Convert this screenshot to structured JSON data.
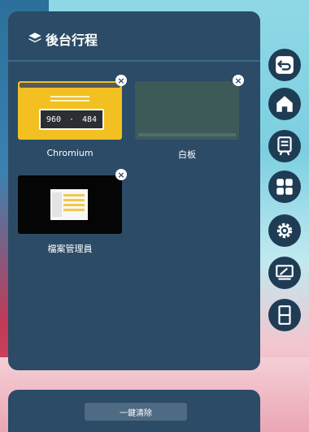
{
  "panel": {
    "title": "後台行程",
    "header_icon": "layers-icon"
  },
  "apps": [
    {
      "name": "Chromium",
      "thumbnail": {
        "display_left": "960",
        "display_right": "484"
      }
    },
    {
      "name": "白板"
    },
    {
      "name": "檔案管理員"
    }
  ],
  "close_icon": "close-icon",
  "close_glyph": "×",
  "bottom": {
    "clear_label": "一鍵清除"
  },
  "toolbar": {
    "buttons": [
      {
        "name": "back-button",
        "icon": "back-icon"
      },
      {
        "name": "home-button",
        "icon": "home-icon"
      },
      {
        "name": "whiteboard-button",
        "icon": "whiteboard-icon"
      },
      {
        "name": "apps-button",
        "icon": "apps-grid-icon"
      },
      {
        "name": "settings-button",
        "icon": "gear-icon"
      },
      {
        "name": "screen-share-button",
        "icon": "screen-share-icon"
      },
      {
        "name": "split-screen-button",
        "icon": "split-screen-icon"
      }
    ]
  },
  "colors": {
    "panel": "#2b4b66",
    "toolbar_button": "#1f3c55",
    "clear_button": "#4f6b84",
    "chromium_thumb": "#f2c021",
    "whiteboard_thumb": "#3d5a59"
  }
}
